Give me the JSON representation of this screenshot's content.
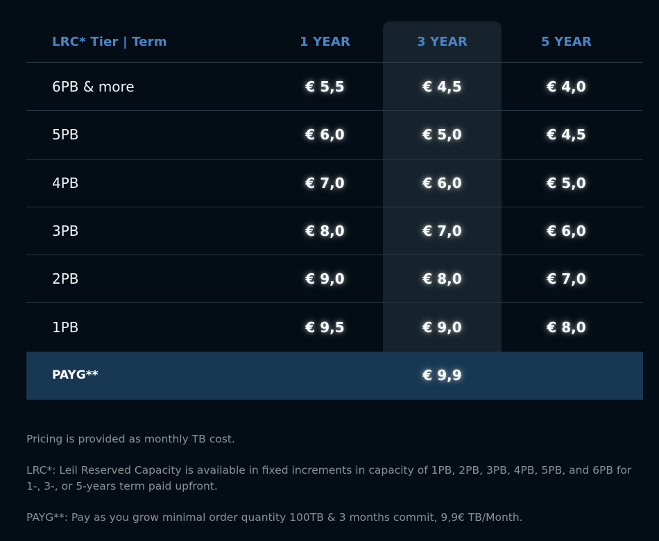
{
  "header": {
    "tier_term": "LRC* Tier | Term",
    "col1": "1 YEAR",
    "col2": "3 YEAR",
    "col3": "5 YEAR"
  },
  "rows": [
    {
      "tier": "6PB & more",
      "y1": "€ 5,5",
      "y3": "€ 4,5",
      "y5": "€ 4,0"
    },
    {
      "tier": "5PB",
      "y1": "€ 6,0",
      "y3": "€ 5,0",
      "y5": "€ 4,5"
    },
    {
      "tier": "4PB",
      "y1": "€ 7,0",
      "y3": "€ 6,0",
      "y5": "€ 5,0"
    },
    {
      "tier": "3PB",
      "y1": "€ 8,0",
      "y3": "€ 7,0",
      "y5": "€ 6,0"
    },
    {
      "tier": "2PB",
      "y1": "€ 9,0",
      "y3": "€ 8,0",
      "y5": "€ 7,0"
    },
    {
      "tier": "1PB",
      "y1": "€ 9,5",
      "y3": "€ 9,0",
      "y5": "€ 8,0"
    }
  ],
  "payg": {
    "label": "PAYG**",
    "value": "€ 9,9"
  },
  "notes": {
    "pricing": "Pricing is provided as monthly TB cost.",
    "lrc": "LRC*: Leil Reserved Capacity is available in fixed increments in capacity of 1PB, 2PB, 3PB, 4PB, 5PB, and 6PB for 1-, 3-, or 5-years term paid upfront.",
    "payg": "PAYG**: Pay as you grow minimal order quantity 100TB & 3 months commit, 9,9€ TB/Month."
  },
  "colors": {
    "background": "#040d15",
    "header_text": "#4a86c7",
    "highlight_column": "#17232c",
    "payg_band": "#183752",
    "note_text": "#8b9197"
  }
}
